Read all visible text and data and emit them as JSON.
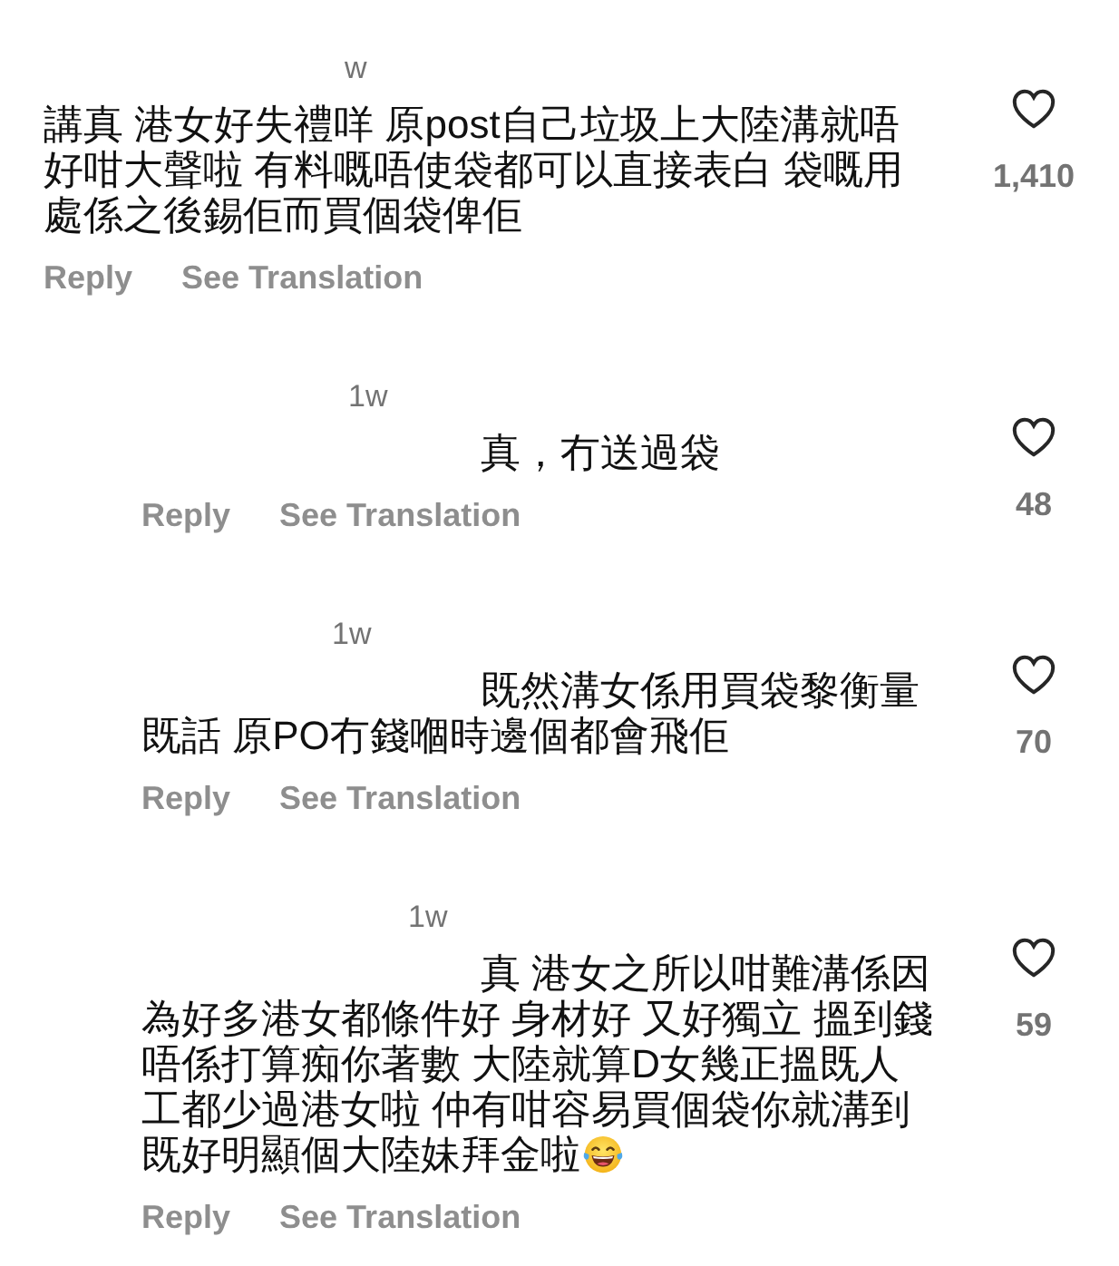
{
  "comments": [
    {
      "time": "w",
      "text": "講真 港女好失禮咩 原post自己垃圾上大陸溝就唔好咁大聲啦 有料嘅唔使袋都可以直接表白 袋嘅用處係之後錫佢而買個袋俾佢",
      "emoji": false,
      "liked": false,
      "likes": "1,410",
      "actions": [
        "Reply",
        "See Translation"
      ],
      "replies": [
        {
          "time": "1w",
          "text": "真，冇送過袋",
          "emoji": false,
          "liked": false,
          "likes": "48",
          "actions": [
            "Reply",
            "See Translation"
          ]
        },
        {
          "time": "1w",
          "text": "既然溝女係用買袋黎衡量既話 原PO冇錢嗰時邊個都會飛佢",
          "emoji": false,
          "liked": false,
          "likes": "70",
          "actions": [
            "Reply",
            "See Translation"
          ]
        },
        {
          "time": "1w",
          "text": "真 港女之所以咁難溝係因為好多港女都條件好 身材好 又好獨立 搵到錢唔係打算痴你著數 大陸就算D女幾正搵既人工都少過港女啦 仲有咁容易買個袋你就溝到既好明顯個大陸妹拜金啦",
          "emoji": true,
          "liked": false,
          "likes": "59",
          "actions": [
            "Reply",
            "See Translation"
          ]
        }
      ]
    }
  ]
}
